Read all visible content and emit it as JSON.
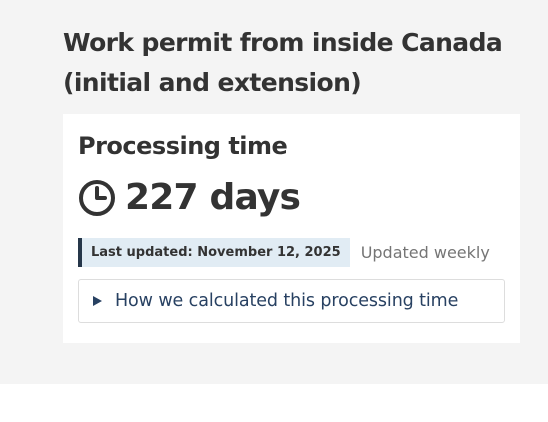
{
  "page": {
    "heading": "Work permit from inside Canada (initial and extension)"
  },
  "card": {
    "title": "Processing time",
    "icon": "clock-icon",
    "time_value": "227 days",
    "last_updated": "Last updated: November 12, 2025",
    "update_frequency": "Updated weekly",
    "details_icon": "triangle-right-icon",
    "details_summary": "How we calculated this processing time"
  },
  "colors": {
    "text": "#333333",
    "link": "#284162",
    "muted": "#757575",
    "label_bg": "#e1ecf4",
    "label_border": "#26374a",
    "panel_bg": "#f4f4f4"
  }
}
